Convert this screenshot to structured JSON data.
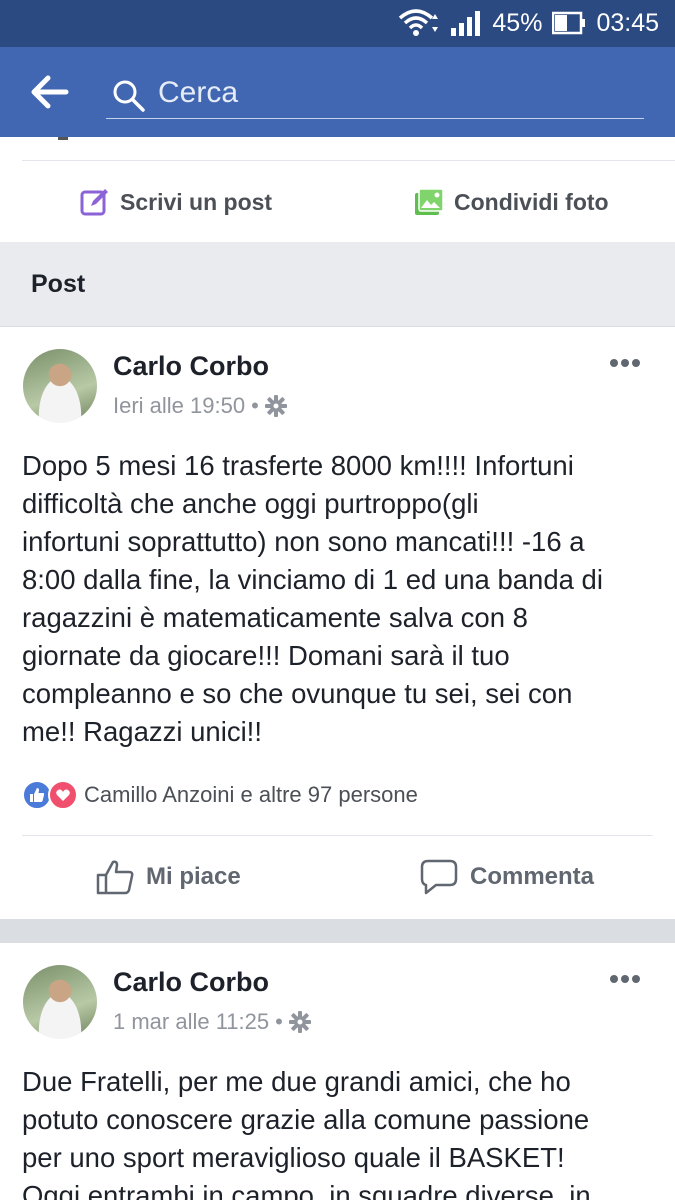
{
  "status_bar": {
    "battery": "45%",
    "time": "03:45"
  },
  "search": {
    "placeholder": "Cerca"
  },
  "composer": {
    "write_post": "Scrivi un post",
    "share_photo": "Condividi foto"
  },
  "section": {
    "title": "Post"
  },
  "posts": [
    {
      "author": "Carlo Corbo",
      "timestamp": "Ieri alle 19:50",
      "separator": "•",
      "text": "Dopo 5 mesi 16 trasferte 8000 km!!!! Infortuni\ndifficoltà che anche oggi purtroppo(gli\ninfortuni soprattutto) non sono mancati!!! -16 a\n8:00 dalla fine, la vinciamo di 1 ed una banda di\nragazzini è matematicamente salva con 8\ngiornate da giocare!!! Domani sarà il tuo\ncompleanno e so che ovunque tu sei, sei con\nme!! Ragazzi unici!!",
      "reactions": "Camillo Anzoini e altre 97 persone",
      "like_label": "Mi piace",
      "comment_label": "Commenta"
    },
    {
      "author": "Carlo Corbo",
      "timestamp": "1 mar alle 11:25",
      "separator": "•",
      "text": "Due Fratelli, per me due grandi amici, che ho\npotuto conoscere grazie alla comune passione\nper uno sport meraviglioso quale il BASKET!\nOggi entrambi in campo, in squadre diverse, in"
    }
  ],
  "icons": {
    "back": "arrow-left-icon",
    "search": "search-icon",
    "write": "edit-icon",
    "photo": "photo-icon",
    "privacy": "gear-icon",
    "more": "more-dots-icon",
    "like": "thumbs-up-icon",
    "comment": "comment-icon"
  },
  "colors": {
    "header": "#4267b2",
    "statusbar": "#2c4a82",
    "write_icon": "#8b63d6",
    "photo_icon": "#5fbf4e",
    "like": "#4a7bd8",
    "love": "#f0506e"
  }
}
